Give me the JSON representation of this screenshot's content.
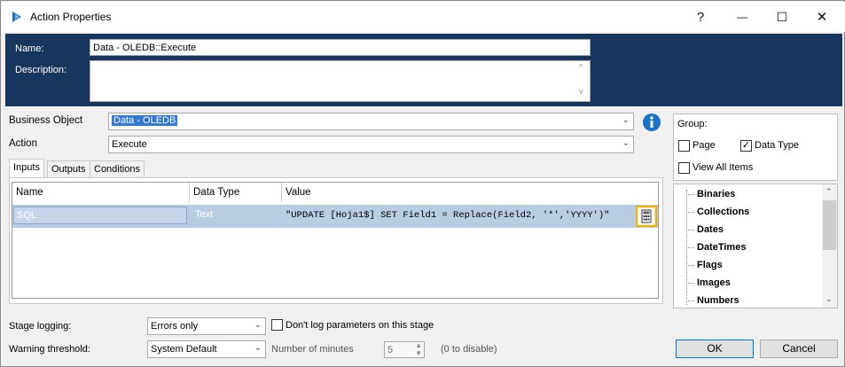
{
  "window": {
    "title": "Action Properties",
    "help_glyph": "?",
    "minimize_glyph": "—",
    "maximize_glyph": "☐",
    "close_glyph": "✕"
  },
  "header": {
    "name_label": "Name:",
    "name_value": "Data - OLEDB::Execute",
    "description_label": "Description:",
    "description_value": ""
  },
  "form": {
    "business_object_label": "Business Object",
    "business_object_value": "Data - OLEDB",
    "action_label": "Action",
    "action_value": "Execute"
  },
  "tabs": [
    {
      "label": "Inputs",
      "active": true
    },
    {
      "label": "Outputs",
      "active": false
    },
    {
      "label": "Conditions",
      "active": false
    }
  ],
  "grid": {
    "columns": [
      "Name",
      "Data Type",
      "Value"
    ],
    "rows": [
      {
        "name": "SQL",
        "data_type": "Text",
        "value": "\"UPDATE [Hoja1$] SET Field1 = Replace(Field2, '*','YYYY')\""
      }
    ]
  },
  "group": {
    "label": "Group:",
    "page_label": "Page",
    "page_checked": false,
    "data_type_label": "Data Type",
    "data_type_checked": true,
    "view_all_label": "View All Items",
    "view_all_checked": false
  },
  "tree_items": [
    "Binaries",
    "Collections",
    "Dates",
    "DateTimes",
    "Flags",
    "Images",
    "Numbers"
  ],
  "footer": {
    "stage_logging_label": "Stage logging:",
    "stage_logging_value": "Errors only",
    "dont_log_label": "Don't log parameters on this stage",
    "warning_label": "Warning threshold:",
    "warning_value": "System Default",
    "minutes_label": "Number of minutes",
    "minutes_value": "5",
    "disable_hint": "(0 to disable)",
    "ok_label": "OK",
    "cancel_label": "Cancel"
  },
  "colors": {
    "header_bg": "#17365d",
    "selection": "#b8cce4",
    "info_icon": "#1a73c8",
    "highlight_border": "#f0b400"
  }
}
